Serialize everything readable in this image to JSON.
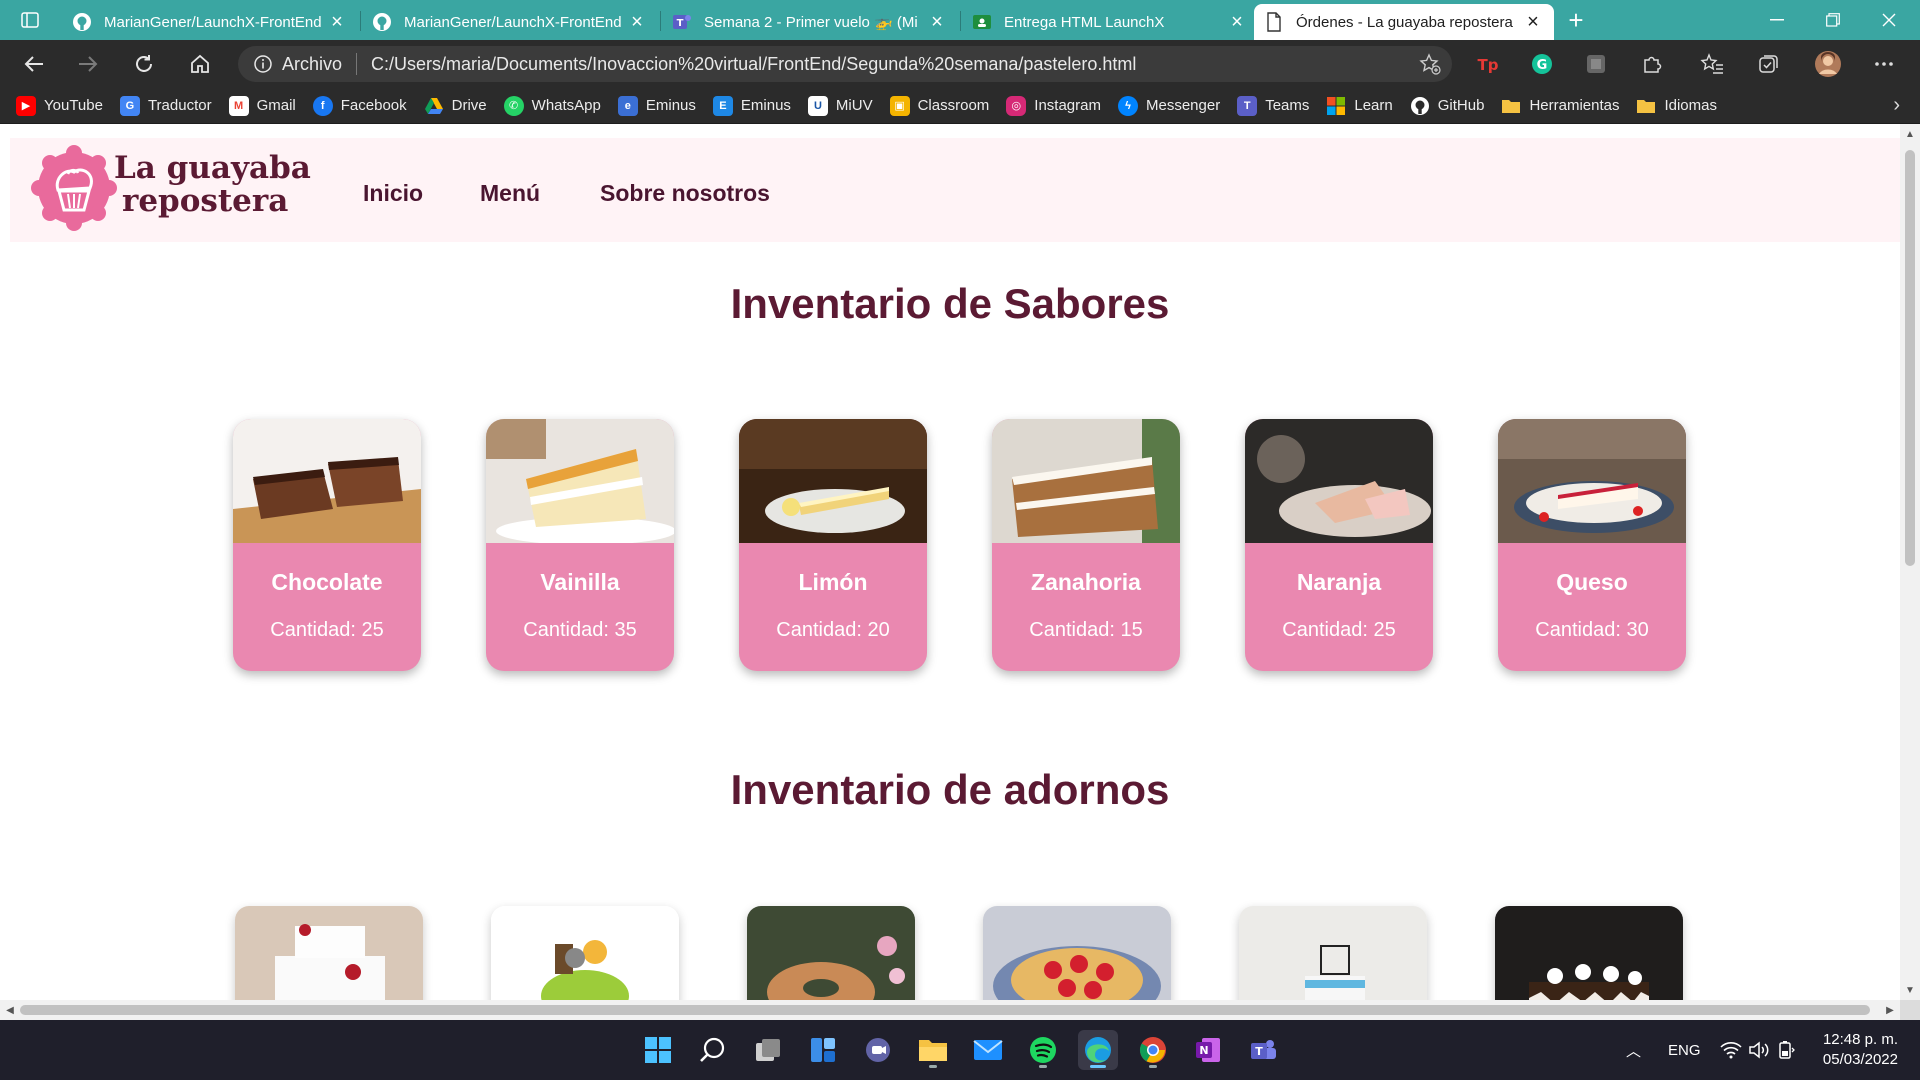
{
  "browser": {
    "tabs": [
      {
        "title": "MarianGener/LaunchX-FrontEnd",
        "icon": "github-icon"
      },
      {
        "title": "MarianGener/LaunchX-FrontEnd",
        "icon": "github-icon"
      },
      {
        "title": "Semana 2 - Primer vuelo 🚁 (Mi",
        "icon": "teams-icon"
      },
      {
        "title": "Entrega HTML LaunchX",
        "icon": "classroom-icon"
      },
      {
        "title": "Órdenes - La guayaba repostera",
        "icon": "document-icon",
        "active": true
      }
    ],
    "address": {
      "label": "Archivo",
      "url": "C:/Users/maria/Documents/Inovaccion%20virtual/FrontEnd/Segunda%20semana/pastelero.html"
    },
    "bookmarks": [
      {
        "label": "YouTube",
        "icon": "youtube-icon",
        "color": "#ff0000"
      },
      {
        "label": "Traductor",
        "icon": "translate-icon",
        "color": "#4285f4"
      },
      {
        "label": "Gmail",
        "icon": "gmail-icon",
        "color": "#ea4335"
      },
      {
        "label": "Facebook",
        "icon": "facebook-icon",
        "color": "#1877f2"
      },
      {
        "label": "Drive",
        "icon": "drive-icon",
        "color": "#34a853"
      },
      {
        "label": "WhatsApp",
        "icon": "whatsapp-icon",
        "color": "#25d366"
      },
      {
        "label": "Eminus",
        "icon": "eminus-icon",
        "color": "#3b6fd4"
      },
      {
        "label": "Eminus",
        "icon": "eminus-e-icon",
        "color": "#1e88e5"
      },
      {
        "label": "MiUV",
        "icon": "miuv-icon",
        "color": "#1a56a6"
      },
      {
        "label": "Classroom",
        "icon": "classroom-icon",
        "color": "#f4b400"
      },
      {
        "label": "Instagram",
        "icon": "instagram-icon",
        "color": "#d62976"
      },
      {
        "label": "Messenger",
        "icon": "messenger-icon",
        "color": "#0084ff"
      },
      {
        "label": "Teams",
        "icon": "teams-icon",
        "color": "#5b5fc7"
      },
      {
        "label": "Learn",
        "icon": "microsoft-icon",
        "color": "#f25022"
      },
      {
        "label": "GitHub",
        "icon": "github-icon",
        "color": "#333333"
      },
      {
        "label": "Herramientas",
        "icon": "folder-icon",
        "color": "#f5c242"
      },
      {
        "label": "Idiomas",
        "icon": "folder-icon",
        "color": "#f5c242"
      }
    ]
  },
  "site": {
    "logo_line1": "La guayaba",
    "logo_line2": "repostera",
    "nav": [
      "Inicio",
      "Menú",
      "Sobre nosotros"
    ],
    "flavors_title": "Inventario de Sabores",
    "flavors": [
      {
        "name": "Chocolate",
        "qty": "Cantidad: 25"
      },
      {
        "name": "Vainilla",
        "qty": "Cantidad: 35"
      },
      {
        "name": "Limón",
        "qty": "Cantidad: 20"
      },
      {
        "name": "Zanahoria",
        "qty": "Cantidad: 15"
      },
      {
        "name": "Naranja",
        "qty": "Cantidad: 25"
      },
      {
        "name": "Queso",
        "qty": "Cantidad: 30"
      }
    ],
    "decorations_title": "Inventario de adornos"
  },
  "taskbar": {
    "lang": "ENG",
    "time": "12:48 p. m.",
    "date": "05/03/2022"
  },
  "colors": {
    "brand_dark": "#5b1a33",
    "card_pink": "#ea88b0",
    "header_bg": "#fff3f6",
    "tabbar": "#3aa6a2"
  }
}
